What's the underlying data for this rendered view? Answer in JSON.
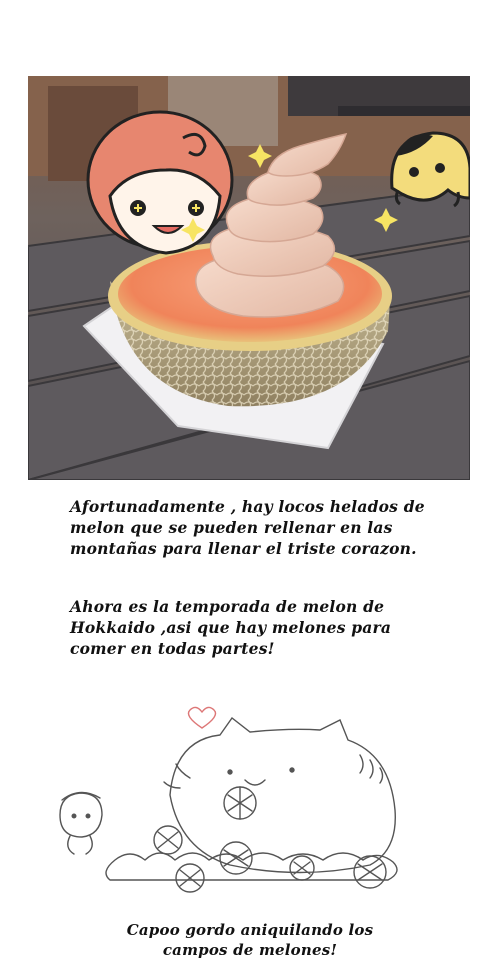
{
  "captions": {
    "paragraph_1": [
      "Afortunadamente , hay locos helados de",
      "melon que se pueden rellenar en las",
      "montañas para llenar el triste corazon."
    ],
    "paragraph_2": [
      "Ahora es la temporada de melon de",
      "Hokkaido ,asi que hay melones para",
      "comer en todas partes!"
    ],
    "footer": [
      "Capoo gordo aniquilando los",
      "campos de melones!"
    ]
  },
  "colors": {
    "background": "#ffffff",
    "caption_text": "#111111",
    "melon_flesh": "#f3936a",
    "melon_rind": "#b8ab86",
    "soft_serve": "#f1cfbf",
    "table_wood": "#5b585b",
    "sticker_hair": "#e7866f",
    "sticker_dog": "#f3dc7c",
    "sparkle": "#f7e463"
  },
  "icons": [
    "girl-face-sticker",
    "dog-face-sticker",
    "sparkle-icon",
    "heart-icon",
    "capoo-cat-sketch",
    "melon-icon"
  ]
}
